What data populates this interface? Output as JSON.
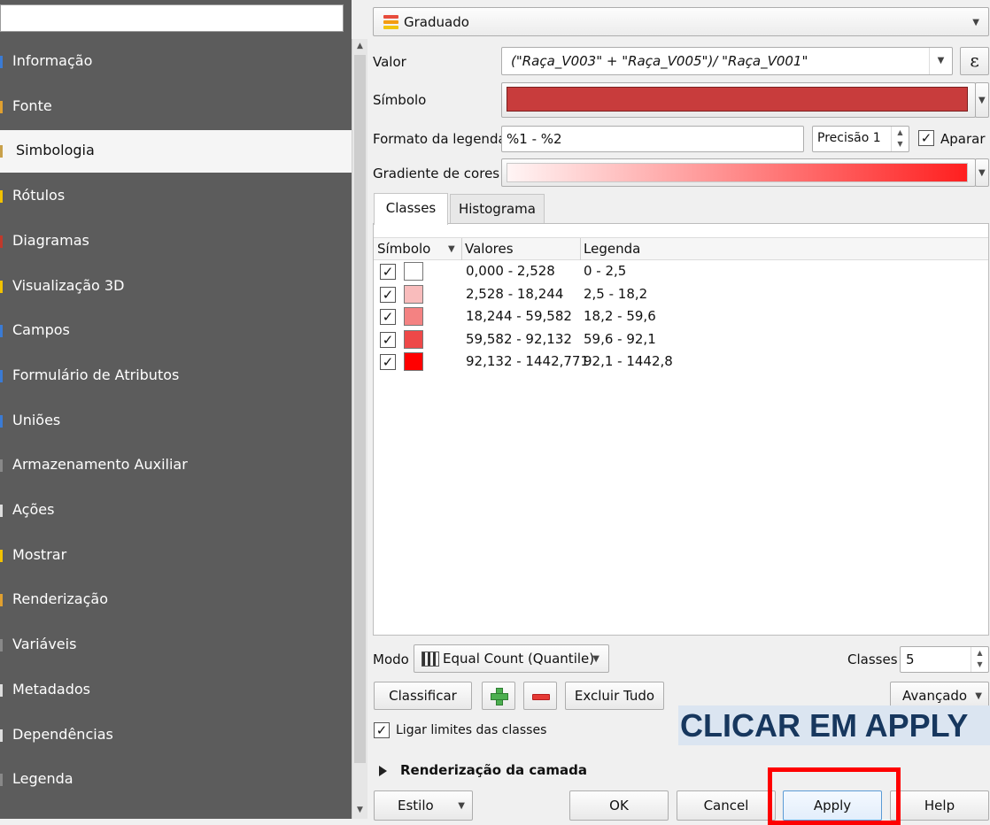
{
  "sidebar": {
    "items": [
      {
        "label": "Informação",
        "mark": "#3a7bd5"
      },
      {
        "label": "Fonte",
        "mark": "#e0a030"
      },
      {
        "label": "Simbologia",
        "mark": "#c9a14a"
      },
      {
        "label": "Rótulos",
        "mark": "#f2c200"
      },
      {
        "label": "Diagramas",
        "mark": "#c0392b"
      },
      {
        "label": "Visualização 3D",
        "mark": "#f2c200"
      },
      {
        "label": "Campos",
        "mark": "#3a7bd5"
      },
      {
        "label": "Formulário de Atributos",
        "mark": "#3a7bd5"
      },
      {
        "label": "Uniões",
        "mark": "#3a7bd5"
      },
      {
        "label": "Armazenamento Auxiliar",
        "mark": "#888888"
      },
      {
        "label": "Ações",
        "mark": "#dddddd"
      },
      {
        "label": "Mostrar",
        "mark": "#f2c200"
      },
      {
        "label": "Renderização",
        "mark": "#e0a030"
      },
      {
        "label": "Variáveis",
        "mark": "#888888"
      },
      {
        "label": "Metadados",
        "mark": "#dddddd"
      },
      {
        "label": "Dependências",
        "mark": "#dddddd"
      },
      {
        "label": "Legenda",
        "mark": "#888888"
      }
    ]
  },
  "renderer": {
    "label": "Graduado"
  },
  "value": {
    "label": "Valor",
    "expression": "(\"Raça_V003\" + \"Raça_V005\")/ \"Raça_V001\"",
    "expr_button": "ε"
  },
  "symbol": {
    "label": "Símbolo",
    "color": "#c83c3c"
  },
  "legend_format": {
    "label": "Formato da legenda",
    "value": "%1 - %2",
    "precision_label": "Precisão",
    "precision_value": "1",
    "trim_label": "Aparar"
  },
  "color_ramp": {
    "label": "Gradiente de cores"
  },
  "tabs": [
    {
      "label": "Classes"
    },
    {
      "label": "Histograma"
    }
  ],
  "table": {
    "headers": {
      "symbol": "Símbolo",
      "values": "Valores",
      "legend": "Legenda"
    },
    "rows": [
      {
        "values": "0,000 - 2,528",
        "legend": "0 - 2,5",
        "color": "#ffffff"
      },
      {
        "values": "2,528 - 18,244",
        "legend": "2,5 - 18,2",
        "color": "#f9bcbc"
      },
      {
        "values": "18,244 - 59,582",
        "legend": "18,2 - 59,6",
        "color": "#f48282"
      },
      {
        "values": "59,582 - 92,132",
        "legend": "59,6 - 92,1",
        "color": "#ee4848"
      },
      {
        "values": "92,132 - 1442,771",
        "legend": "92,1 - 1442,8",
        "color": "#ff0000"
      }
    ]
  },
  "mode": {
    "label": "Modo",
    "value": "Equal Count (Quantile)",
    "classes_label": "Classes",
    "classes_value": "5"
  },
  "buttons": {
    "classify": "Classificar",
    "delete_all": "Excluir Tudo",
    "advanced": "Avançado",
    "style": "Estilo",
    "ok": "OK",
    "cancel": "Cancel",
    "apply": "Apply",
    "help": "Help"
  },
  "link_class_limits": {
    "label": "Ligar limites das classes"
  },
  "layer_rendering": {
    "label": "Renderização da camada"
  },
  "annotation": {
    "text": "CLICAR EM APPLY"
  }
}
